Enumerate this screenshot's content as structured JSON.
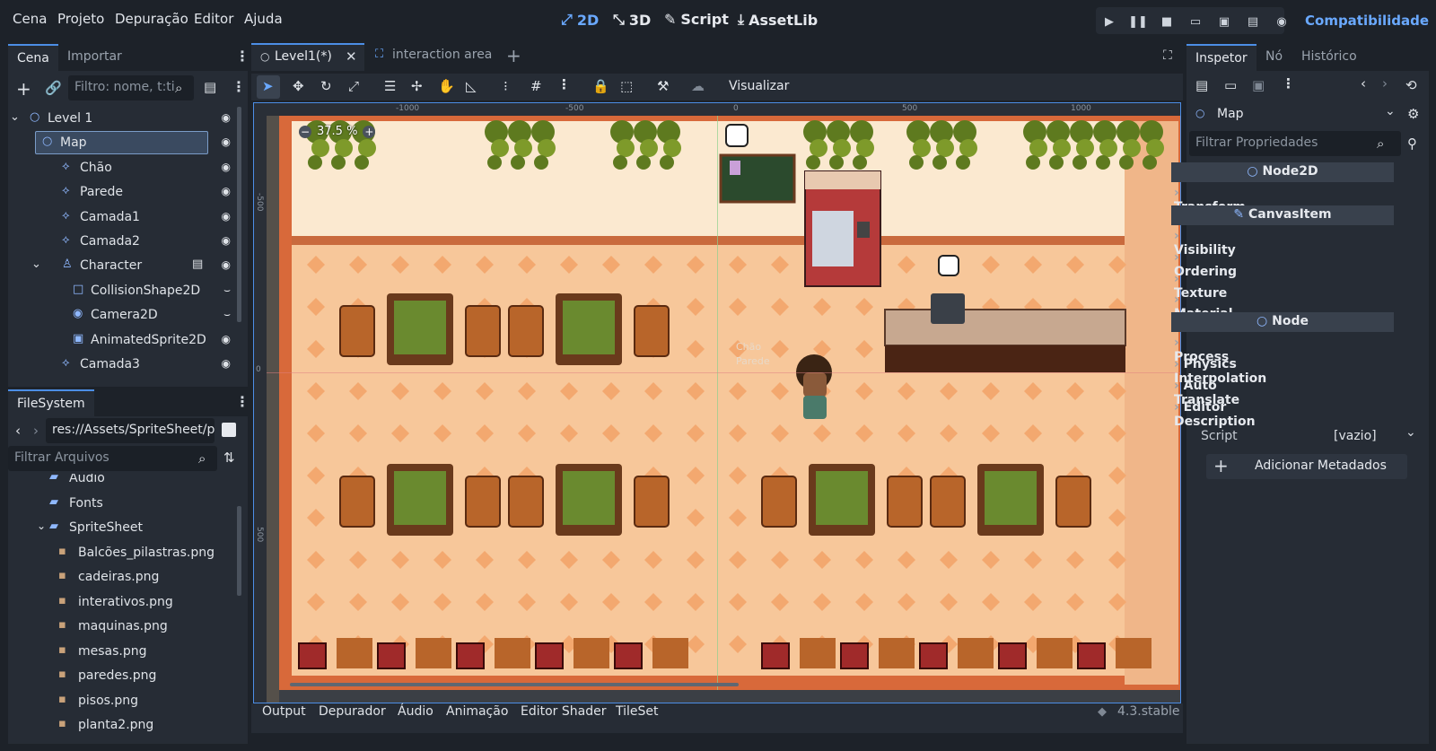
{
  "menu": [
    "Cena",
    "Projeto",
    "Depuração",
    "Editor",
    "Ajuda"
  ],
  "workspaces": [
    {
      "label": "2D",
      "icon": "2d-icon",
      "active": true
    },
    {
      "label": "3D",
      "icon": "3d-icon",
      "active": false
    },
    {
      "label": "Script",
      "icon": "script-icon",
      "active": false
    },
    {
      "label": "AssetLib",
      "icon": "assetlib-icon",
      "active": false
    }
  ],
  "renderer": "Compatibilidade",
  "scene_dock": {
    "tabs": [
      "Cena",
      "Importar"
    ],
    "filter_placeholder": "Filtro: nome, t:ti",
    "tree": [
      {
        "label": "Level 1",
        "depth": 0,
        "icon": "node2d-icon",
        "eye": true
      },
      {
        "label": "Map",
        "depth": 1,
        "icon": "node2d-icon",
        "eye": true,
        "selected": true
      },
      {
        "label": "Chão",
        "depth": 2,
        "icon": "tilemap-icon",
        "eye": true
      },
      {
        "label": "Parede",
        "depth": 2,
        "icon": "tilemap-icon",
        "eye": true
      },
      {
        "label": "Camada1",
        "depth": 2,
        "icon": "tilemap-icon",
        "eye": true
      },
      {
        "label": "Camada2",
        "depth": 2,
        "icon": "tilemap-icon",
        "eye": true
      },
      {
        "label": "Character",
        "depth": 2,
        "icon": "character-icon",
        "eye": true,
        "script": true,
        "expanded": true
      },
      {
        "label": "CollisionShape2D",
        "depth": 3,
        "icon": "collision-icon",
        "eye": false
      },
      {
        "label": "Camera2D",
        "depth": 3,
        "icon": "camera-icon",
        "eye": false
      },
      {
        "label": "AnimatedSprite2D",
        "depth": 3,
        "icon": "sprite-icon",
        "eye": true
      },
      {
        "label": "Camada3",
        "depth": 2,
        "icon": "tilemap-icon",
        "eye": true
      }
    ]
  },
  "filesystem": {
    "title": "FileSystem",
    "path": "res://Assets/SpriteSheet/pl",
    "filter_placeholder": "Filtrar Arquivos",
    "items": [
      {
        "label": "Audio",
        "type": "folder",
        "depth": 1
      },
      {
        "label": "Fonts",
        "type": "folder",
        "depth": 1
      },
      {
        "label": "SpriteSheet",
        "type": "folder",
        "depth": 1,
        "open": true
      },
      {
        "label": "Balcões_pilastras.png",
        "type": "file",
        "depth": 2
      },
      {
        "label": "cadeiras.png",
        "type": "file",
        "depth": 2
      },
      {
        "label": "interativos.png",
        "type": "file",
        "depth": 2
      },
      {
        "label": "maquinas.png",
        "type": "file",
        "depth": 2
      },
      {
        "label": "mesas.png",
        "type": "file",
        "depth": 2
      },
      {
        "label": "paredes.png",
        "type": "file",
        "depth": 2
      },
      {
        "label": "pisos.png",
        "type": "file",
        "depth": 2
      },
      {
        "label": "planta2.png",
        "type": "file",
        "depth": 2
      }
    ]
  },
  "editor_tabs": [
    "Level1(*)",
    "interaction area"
  ],
  "toolbar": {
    "view_label": "Visualizar"
  },
  "viewport": {
    "zoom": "37.5 %",
    "ruler_top": [
      "-1000",
      "-500",
      "0",
      "500",
      "1000"
    ],
    "ruler_left": [
      "-500",
      "0",
      "500"
    ],
    "tile_labels": [
      "Chão",
      "Parede"
    ],
    "colors": {
      "floor": "#f7c79a",
      "wall": "#fbe9d0",
      "trim": "#d8693a",
      "table": "#6a8a2f"
    }
  },
  "inspector": {
    "tabs": [
      "Inspetor",
      "Nó",
      "Histórico"
    ],
    "node": "Map",
    "filter_placeholder": "Filtrar Propriedades",
    "sections": [
      {
        "type": "head",
        "label": "Node2D",
        "icon": "node2d-icon"
      },
      {
        "type": "item",
        "label": "Transform"
      },
      {
        "type": "head",
        "label": "CanvasItem",
        "icon": "brush-icon"
      },
      {
        "type": "item",
        "label": "Visibility"
      },
      {
        "type": "item",
        "label": "Ordering"
      },
      {
        "type": "item",
        "label": "Texture"
      },
      {
        "type": "item",
        "label": "Material"
      },
      {
        "type": "head",
        "label": "Node",
        "icon": "node-icon"
      },
      {
        "type": "item",
        "label": "Process"
      },
      {
        "type": "item",
        "label": "Physics Interpolation"
      },
      {
        "type": "item",
        "label": "Auto Translate"
      },
      {
        "type": "item",
        "label": "Editor Description"
      }
    ],
    "script_label": "Script",
    "script_value": "[vazio]",
    "add_meta": "Adicionar Metadados"
  },
  "bottom_tabs": [
    "Output",
    "Depurador",
    "Áudio",
    "Animação",
    "Editor Shader",
    "TileSet"
  ],
  "version": "4.3.stable"
}
